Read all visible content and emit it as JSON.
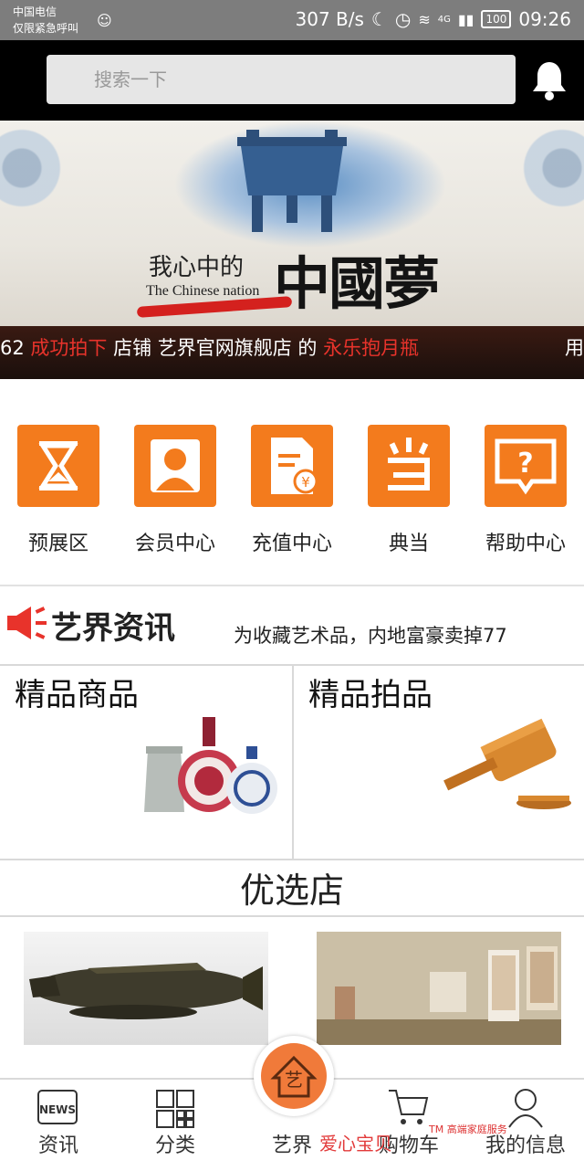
{
  "status_bar": {
    "carrier": "中国电信",
    "emergency": "仅限紧急呼叫",
    "speed": "307 B/s",
    "network": "4G",
    "battery": "100",
    "time": "09:26"
  },
  "header": {
    "search_placeholder": "搜索一下"
  },
  "banner": {
    "tagline": "我心中的",
    "subtag": "The Chinese nation",
    "title": "中國夢"
  },
  "ticker": {
    "prefix": "62 ",
    "action": "成功拍下",
    "middle": " 店铺 艺界官网旗舰店 的 ",
    "item": "永乐抱月瓶",
    "tail": "用"
  },
  "quick_actions": [
    {
      "label": "预展区",
      "icon": "hourglass-icon"
    },
    {
      "label": "会员中心",
      "icon": "user-icon"
    },
    {
      "label": "充值中心",
      "icon": "invoice-yen-icon"
    },
    {
      "label": "典当",
      "icon": "pawn-dang-icon"
    },
    {
      "label": "帮助中心",
      "icon": "help-bubble-icon"
    }
  ],
  "news": {
    "title": "艺界资讯",
    "headline": "为收藏艺术品，内地富豪卖掉77"
  },
  "featured": {
    "goods_title": "精品商品",
    "auction_title": "精品拍品"
  },
  "preferred": {
    "title": "优选店"
  },
  "bottom_nav": {
    "news": "资讯",
    "category": "分类",
    "home": "艺界",
    "cart": "购物车",
    "me": "我的信息",
    "home_badge": "艺"
  },
  "watermark": {
    "text": "爱心宝贝",
    "sub": "TM 高端家庭服务"
  },
  "colors": {
    "accent": "#f37b1d",
    "highlight": "#e8332b",
    "header_bg": "#000000"
  }
}
